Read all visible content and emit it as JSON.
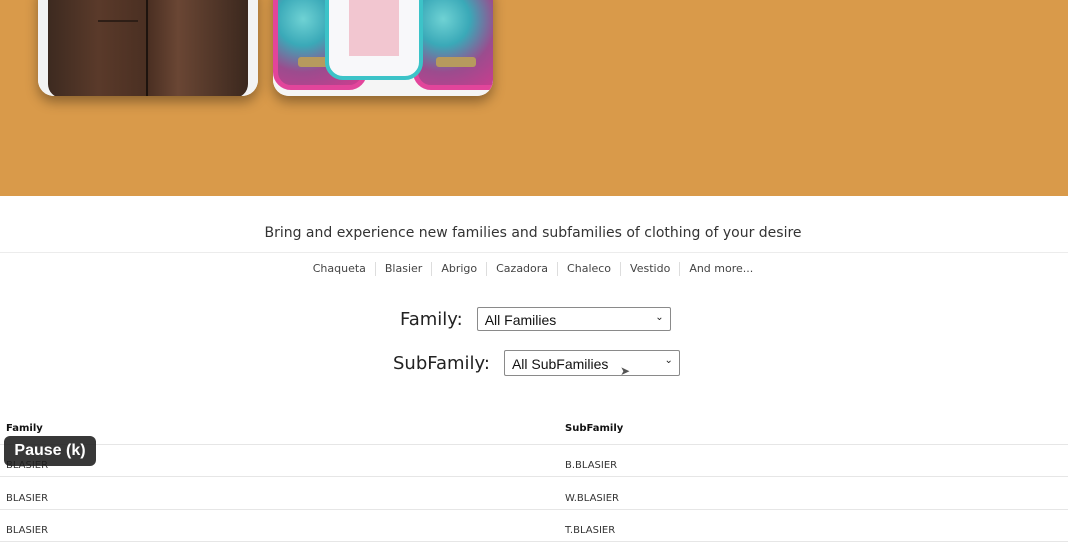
{
  "tagline": "Bring and experience new families and subfamilies of clothing of your desire",
  "links": [
    "Chaqueta",
    "Blasier",
    "Abrigo",
    "Cazadora",
    "Chaleco",
    "Vestido",
    "And more..."
  ],
  "filters": {
    "family_label": "Family:",
    "family_value": "All Families",
    "subfamily_label": "SubFamily:",
    "subfamily_value": "All SubFamilies"
  },
  "table": {
    "headers": [
      "Family",
      "SubFamily"
    ],
    "rows": [
      [
        "BLASIER",
        "B.BLASIER"
      ],
      [
        "BLASIER",
        "W.BLASIER"
      ],
      [
        "BLASIER",
        "T.BLASIER"
      ]
    ]
  },
  "overlay": {
    "pause_label": "Pause (k)"
  },
  "colors": {
    "hero_bg": "#d99a4a"
  }
}
